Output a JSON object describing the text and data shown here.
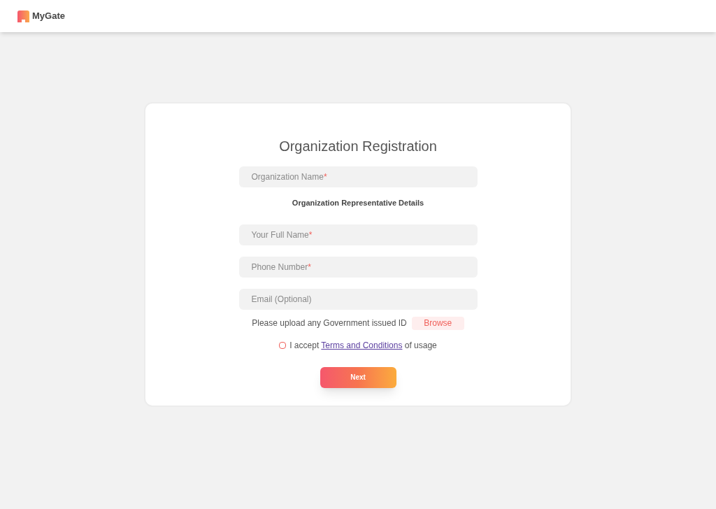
{
  "header": {
    "brand": "MyGate"
  },
  "form": {
    "title": "Organization Registration",
    "fields": [
      {
        "placeholder": "Organization Name",
        "required_mark": "*"
      }
    ],
    "section_title": "Organization Representative Details",
    "rep_fields": [
      {
        "placeholder": "Your Full Name",
        "required_mark": "*"
      },
      {
        "placeholder": "Phone Number",
        "required_mark": "*"
      },
      {
        "placeholder": "Email (Optional)"
      }
    ],
    "upload": {
      "label": "Please upload any Government issued ID",
      "button": "Browse"
    },
    "terms": {
      "checked": false,
      "before": "I accept",
      "link": "Terms and Conditions",
      "after": "of usage"
    },
    "submit": "Next"
  }
}
